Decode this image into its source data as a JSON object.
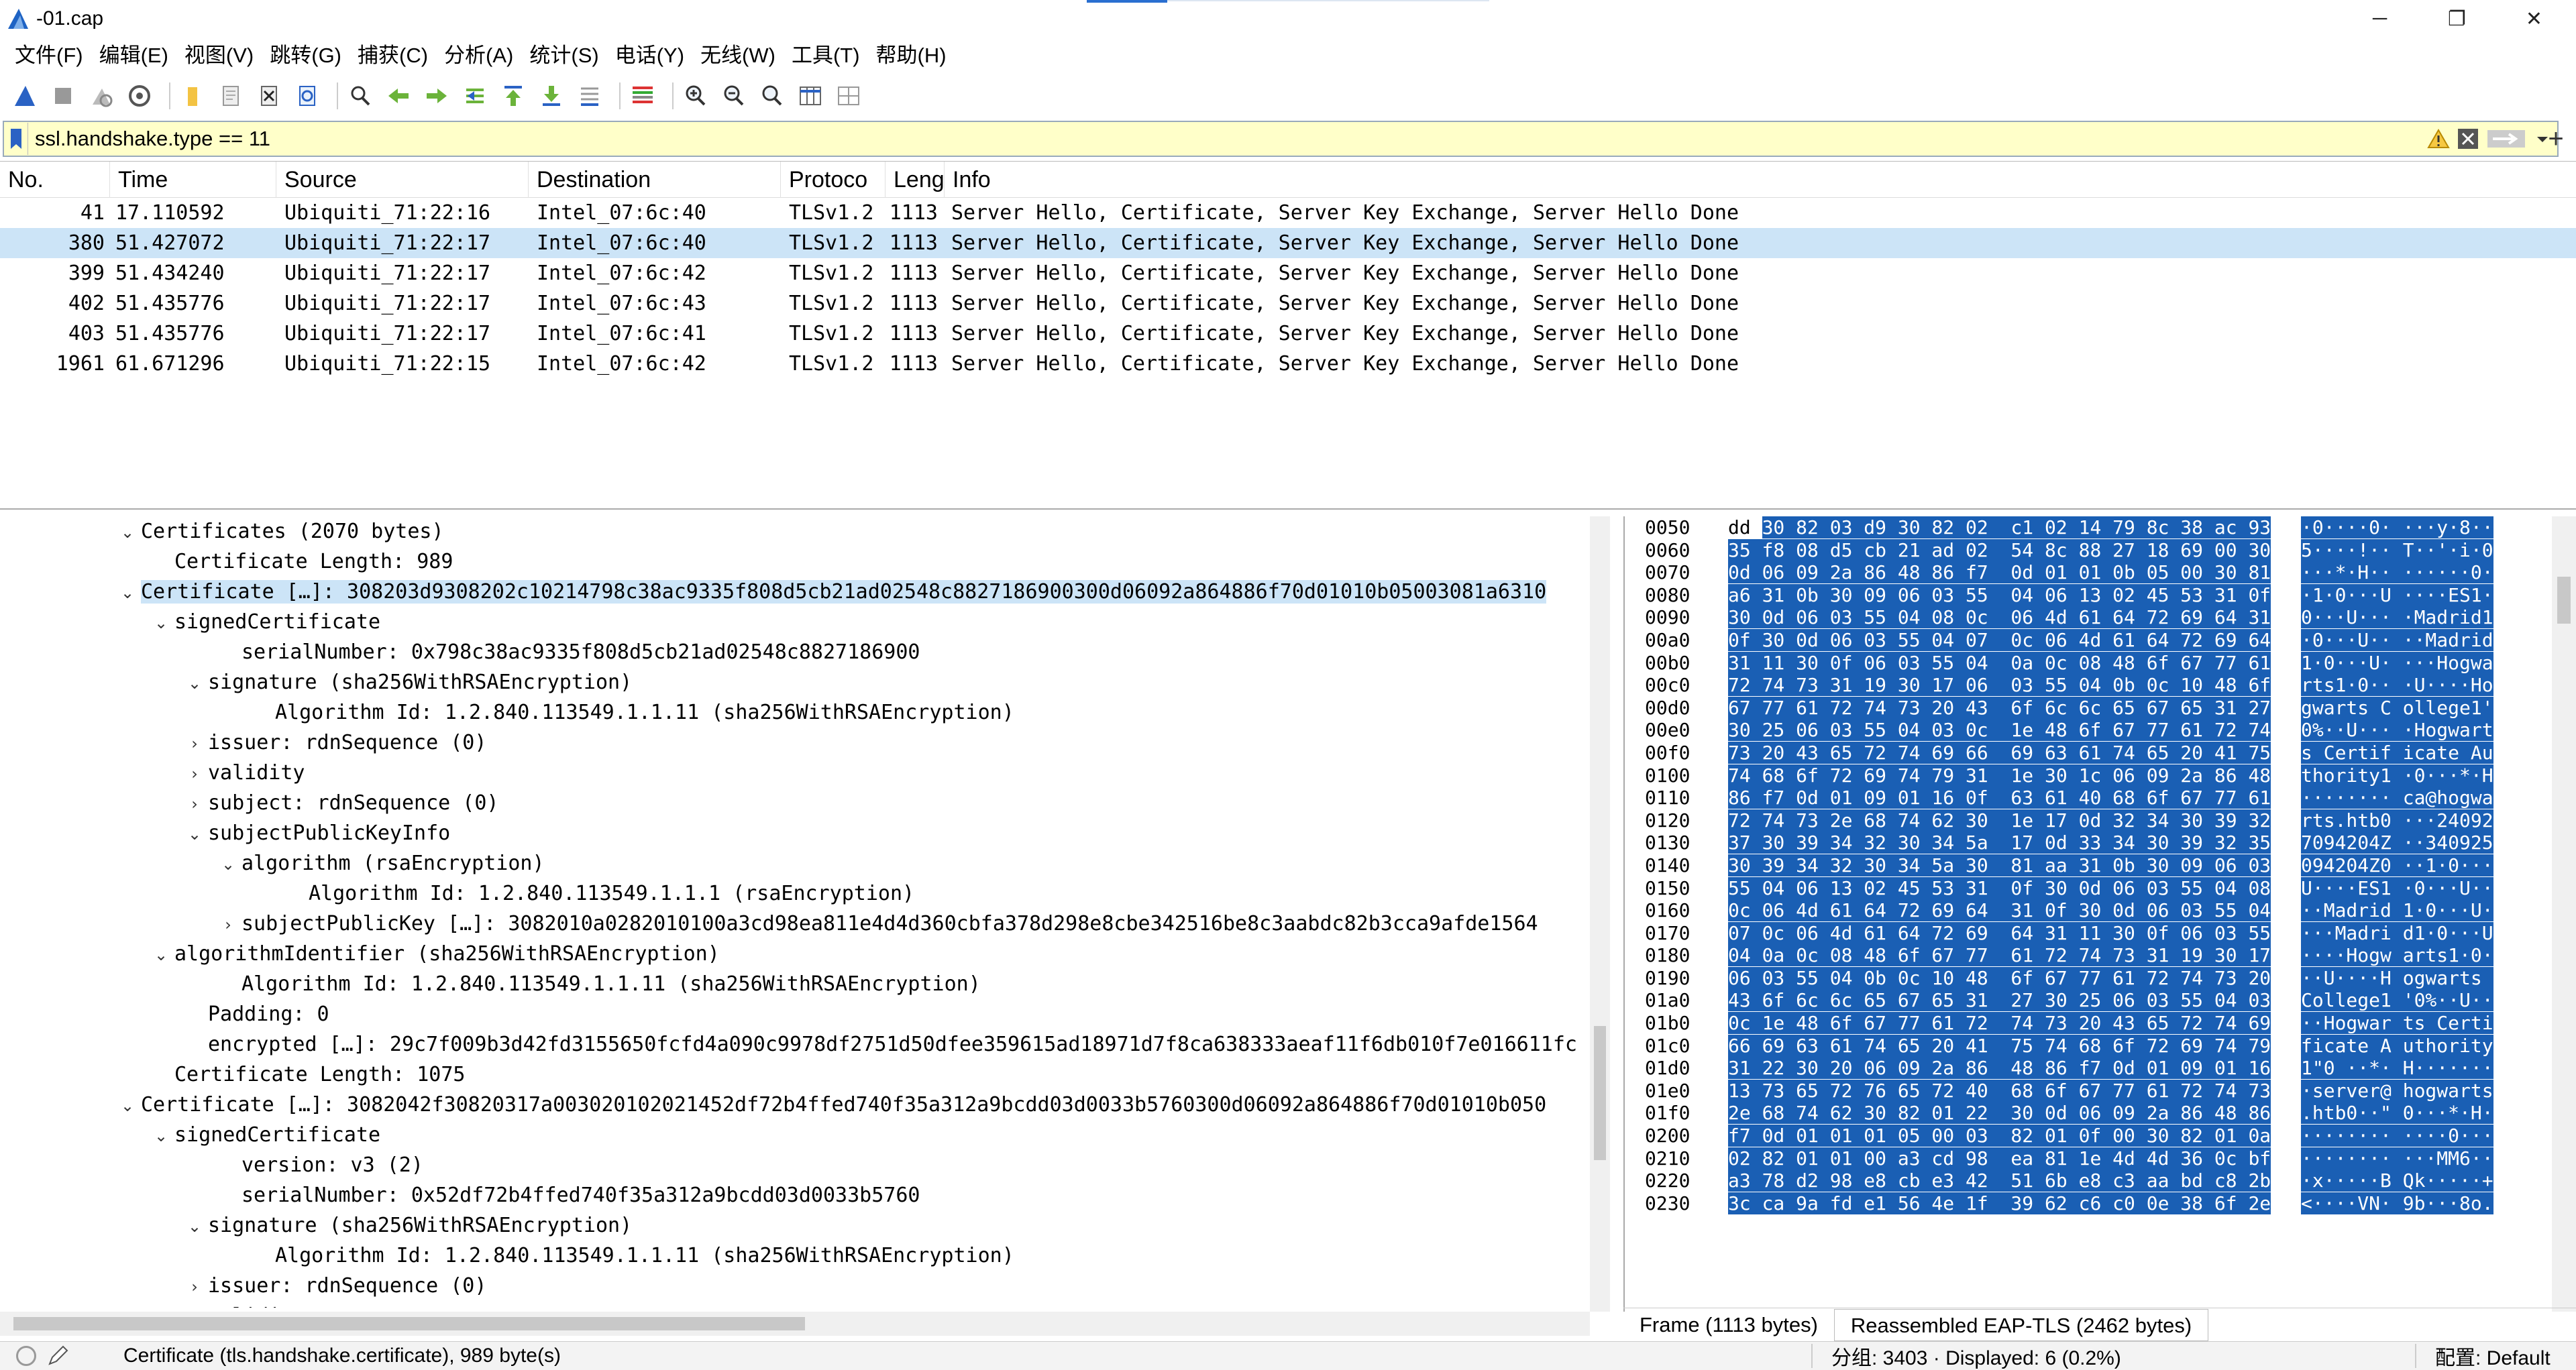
{
  "window": {
    "title": "-01.cap",
    "minimize": "─",
    "restore": "❐",
    "close": "✕"
  },
  "menu": [
    "文件(F)",
    "编辑(E)",
    "视图(V)",
    "跳转(G)",
    "捕获(C)",
    "分析(A)",
    "统计(S)",
    "电话(Y)",
    "无线(W)",
    "工具(T)",
    "帮助(H)"
  ],
  "toolbar_icons": [
    "shark-fin-start-icon",
    "stop-icon",
    "restart-icon",
    "capture-options-icon",
    "open-folder-icon",
    "save-icon",
    "close-file-icon",
    "reload-icon",
    "find-icon",
    "back-arrow-icon",
    "forward-arrow-icon",
    "go-to-packet-icon",
    "first-packet-icon",
    "last-packet-icon",
    "autoscroll-icon",
    "colorize-icon",
    "zoom-in-icon",
    "zoom-out-icon",
    "zoom-normal-icon",
    "resize-columns-icon",
    "layout-icon"
  ],
  "filter": {
    "value": "ssl.handshake.type == 11",
    "bg_color": "#ffffc9"
  },
  "packet_list": {
    "columns": [
      "No.",
      "Time",
      "Source",
      "Destination",
      "Protoco",
      "Lengt",
      "Info"
    ],
    "rows": [
      {
        "no": "41",
        "time": "17.110592",
        "src": "Ubiquiti_71:22:16",
        "dst": "Intel_07:6c:40",
        "proto": "TLSv1.2",
        "len": "1113",
        "info": "Server Hello, Certificate, Server Key Exchange, Server Hello Done"
      },
      {
        "no": "380",
        "time": "51.427072",
        "src": "Ubiquiti_71:22:17",
        "dst": "Intel_07:6c:40",
        "proto": "TLSv1.2",
        "len": "1113",
        "info": "Server Hello, Certificate, Server Key Exchange, Server Hello Done"
      },
      {
        "no": "399",
        "time": "51.434240",
        "src": "Ubiquiti_71:22:17",
        "dst": "Intel_07:6c:42",
        "proto": "TLSv1.2",
        "len": "1113",
        "info": "Server Hello, Certificate, Server Key Exchange, Server Hello Done"
      },
      {
        "no": "402",
        "time": "51.435776",
        "src": "Ubiquiti_71:22:17",
        "dst": "Intel_07:6c:43",
        "proto": "TLSv1.2",
        "len": "1113",
        "info": "Server Hello, Certificate, Server Key Exchange, Server Hello Done"
      },
      {
        "no": "403",
        "time": "51.435776",
        "src": "Ubiquiti_71:22:17",
        "dst": "Intel_07:6c:41",
        "proto": "TLSv1.2",
        "len": "1113",
        "info": "Server Hello, Certificate, Server Key Exchange, Server Hello Done"
      },
      {
        "no": "1961",
        "time": "61.671296",
        "src": "Ubiquiti_71:22:15",
        "dst": "Intel_07:6c:42",
        "proto": "TLSv1.2",
        "len": "1113",
        "info": "Server Hello, Certificate, Server Key Exchange, Server Hello Done"
      }
    ],
    "selected_no": "380"
  },
  "details": [
    {
      "indent": 4,
      "exp": "open",
      "text": "Certificates (2070 bytes)"
    },
    {
      "indent": 5,
      "exp": "none",
      "text": "Certificate Length: 989"
    },
    {
      "indent": 4,
      "exp": "open",
      "text": "Certificate […]: 308203d9308202c10214798c38ac9335f808d5cb21ad02548c8827186900300d06092a864886f70d01010b05003081a6310",
      "selected": true
    },
    {
      "indent": 5,
      "exp": "open",
      "text": "signedCertificate"
    },
    {
      "indent": 7,
      "exp": "none",
      "text": "serialNumber: 0x798c38ac9335f808d5cb21ad02548c8827186900"
    },
    {
      "indent": 6,
      "exp": "open",
      "text": "signature (sha256WithRSAEncryption)"
    },
    {
      "indent": 8,
      "exp": "none",
      "text": "Algorithm Id: 1.2.840.113549.1.1.11 (sha256WithRSAEncryption)"
    },
    {
      "indent": 6,
      "exp": "closed",
      "text": "issuer: rdnSequence (0)"
    },
    {
      "indent": 6,
      "exp": "closed",
      "text": "validity"
    },
    {
      "indent": 6,
      "exp": "closed",
      "text": "subject: rdnSequence (0)"
    },
    {
      "indent": 6,
      "exp": "open",
      "text": "subjectPublicKeyInfo"
    },
    {
      "indent": 7,
      "exp": "open",
      "text": "algorithm (rsaEncryption)"
    },
    {
      "indent": 9,
      "exp": "none",
      "text": "Algorithm Id: 1.2.840.113549.1.1.1 (rsaEncryption)"
    },
    {
      "indent": 7,
      "exp": "closed",
      "text": "subjectPublicKey […]: 3082010a0282010100a3cd98ea811e4d4d360cbfa378d298e8cbe342516be8c3aabdc82b3cca9afde1564"
    },
    {
      "indent": 5,
      "exp": "open",
      "text": "algorithmIdentifier (sha256WithRSAEncryption)"
    },
    {
      "indent": 7,
      "exp": "none",
      "text": "Algorithm Id: 1.2.840.113549.1.1.11 (sha256WithRSAEncryption)"
    },
    {
      "indent": 6,
      "exp": "none",
      "text": "Padding: 0"
    },
    {
      "indent": 6,
      "exp": "none",
      "text": "encrypted […]: 29c7f009b3d42fd3155650fcfd4a090c9978df2751d50dfee359615ad18971d7f8ca638333aeaf11f6db010f7e016611fc"
    },
    {
      "indent": 5,
      "exp": "none",
      "text": "Certificate Length: 1075"
    },
    {
      "indent": 4,
      "exp": "open",
      "text": "Certificate […]: 3082042f30820317a003020102021452df72b4ffed740f35a312a9bcdd03d0033b5760300d06092a864886f70d01010b050"
    },
    {
      "indent": 5,
      "exp": "open",
      "text": "signedCertificate"
    },
    {
      "indent": 7,
      "exp": "none",
      "text": "version: v3 (2)"
    },
    {
      "indent": 7,
      "exp": "none",
      "text": "serialNumber: 0x52df72b4ffed740f35a312a9bcdd03d0033b5760"
    },
    {
      "indent": 6,
      "exp": "open",
      "text": "signature (sha256WithRSAEncryption)"
    },
    {
      "indent": 8,
      "exp": "none",
      "text": "Algorithm Id: 1.2.840.113549.1.1.11 (sha256WithRSAEncryption)"
    },
    {
      "indent": 6,
      "exp": "closed",
      "text": "issuer: rdnSequence (0)"
    },
    {
      "indent": 6,
      "exp": "closed",
      "text": "validity"
    }
  ],
  "bytes": [
    {
      "off": "0050",
      "pre": "dd ",
      "hex": "30 82 03 d9 30 82 02  c1 02 14 79 8c 38 ac 93",
      "asc": "·0····0· ···y·8··"
    },
    {
      "off": "0060",
      "pre": "",
      "hex": "35 f8 08 d5 cb 21 ad 02  54 8c 88 27 18 69 00 30",
      "asc": "5····!·· T··'·i·0"
    },
    {
      "off": "0070",
      "pre": "",
      "hex": "0d 06 09 2a 86 48 86 f7  0d 01 01 0b 05 00 30 81",
      "asc": "···*·H·· ······0·"
    },
    {
      "off": "0080",
      "pre": "",
      "hex": "a6 31 0b 30 09 06 03 55  04 06 13 02 45 53 31 0f",
      "asc": "·1·0···U ····ES1·"
    },
    {
      "off": "0090",
      "pre": "",
      "hex": "30 0d 06 03 55 04 08 0c  06 4d 61 64 72 69 64 31",
      "asc": "0···U··· ·Madrid1"
    },
    {
      "off": "00a0",
      "pre": "",
      "hex": "0f 30 0d 06 03 55 04 07  0c 06 4d 61 64 72 69 64",
      "asc": "·0···U·· ··Madrid"
    },
    {
      "off": "00b0",
      "pre": "",
      "hex": "31 11 30 0f 06 03 55 04  0a 0c 08 48 6f 67 77 61",
      "asc": "1·0···U· ···Hogwa"
    },
    {
      "off": "00c0",
      "pre": "",
      "hex": "72 74 73 31 19 30 17 06  03 55 04 0b 0c 10 48 6f",
      "asc": "rts1·0·· ·U····Ho"
    },
    {
      "off": "00d0",
      "pre": "",
      "hex": "67 77 61 72 74 73 20 43  6f 6c 6c 65 67 65 31 27",
      "asc": "gwarts C ollege1'"
    },
    {
      "off": "00e0",
      "pre": "",
      "hex": "30 25 06 03 55 04 03 0c  1e 48 6f 67 77 61 72 74",
      "asc": "0%··U··· ·Hogwart"
    },
    {
      "off": "00f0",
      "pre": "",
      "hex": "73 20 43 65 72 74 69 66  69 63 61 74 65 20 41 75",
      "asc": "s Certif icate Au"
    },
    {
      "off": "0100",
      "pre": "",
      "hex": "74 68 6f 72 69 74 79 31  1e 30 1c 06 09 2a 86 48",
      "asc": "thority1 ·0···*·H"
    },
    {
      "off": "0110",
      "pre": "",
      "hex": "86 f7 0d 01 09 01 16 0f  63 61 40 68 6f 67 77 61",
      "asc": "········ ca@hogwa"
    },
    {
      "off": "0120",
      "pre": "",
      "hex": "72 74 73 2e 68 74 62 30  1e 17 0d 32 34 30 39 32",
      "asc": "rts.htb0 ···24092"
    },
    {
      "off": "0130",
      "pre": "",
      "hex": "37 30 39 34 32 30 34 5a  17 0d 33 34 30 39 32 35",
      "asc": "7094204Z ··340925"
    },
    {
      "off": "0140",
      "pre": "",
      "hex": "30 39 34 32 30 34 5a 30  81 aa 31 0b 30 09 06 03",
      "asc": "094204Z0 ··1·0···"
    },
    {
      "off": "0150",
      "pre": "",
      "hex": "55 04 06 13 02 45 53 31  0f 30 0d 06 03 55 04 08",
      "asc": "U····ES1 ·0···U··"
    },
    {
      "off": "0160",
      "pre": "",
      "hex": "0c 06 4d 61 64 72 69 64  31 0f 30 0d 06 03 55 04",
      "asc": "··Madrid 1·0···U·"
    },
    {
      "off": "0170",
      "pre": "",
      "hex": "07 0c 06 4d 61 64 72 69  64 31 11 30 0f 06 03 55",
      "asc": "···Madri d1·0···U"
    },
    {
      "off": "0180",
      "pre": "",
      "hex": "04 0a 0c 08 48 6f 67 77  61 72 74 73 31 19 30 17",
      "asc": "····Hogw arts1·0·"
    },
    {
      "off": "0190",
      "pre": "",
      "hex": "06 03 55 04 0b 0c 10 48  6f 67 77 61 72 74 73 20",
      "asc": "··U····H ogwarts "
    },
    {
      "off": "01a0",
      "pre": "",
      "hex": "43 6f 6c 6c 65 67 65 31  27 30 25 06 03 55 04 03",
      "asc": "College1 '0%··U··"
    },
    {
      "off": "01b0",
      "pre": "",
      "hex": "0c 1e 48 6f 67 77 61 72  74 73 20 43 65 72 74 69",
      "asc": "··Hogwar ts Certi"
    },
    {
      "off": "01c0",
      "pre": "",
      "hex": "66 69 63 61 74 65 20 41  75 74 68 6f 72 69 74 79",
      "asc": "ficate A uthority"
    },
    {
      "off": "01d0",
      "pre": "",
      "hex": "31 22 30 20 06 09 2a 86  48 86 f7 0d 01 09 01 16",
      "asc": "1\"0 ··*· H·······"
    },
    {
      "off": "01e0",
      "pre": "",
      "hex": "13 73 65 72 76 65 72 40  68 6f 67 77 61 72 74 73",
      "asc": "·server@ hogwarts"
    },
    {
      "off": "01f0",
      "pre": "",
      "hex": "2e 68 74 62 30 82 01 22  30 0d 06 09 2a 86 48 86",
      "asc": ".htb0··\" 0···*·H·"
    },
    {
      "off": "0200",
      "pre": "",
      "hex": "f7 0d 01 01 01 05 00 03  82 01 0f 00 30 82 01 0a",
      "asc": "········ ····0···"
    },
    {
      "off": "0210",
      "pre": "",
      "hex": "02 82 01 01 00 a3 cd 98  ea 81 1e 4d 4d 36 0c bf",
      "asc": "········ ···MM6··"
    },
    {
      "off": "0220",
      "pre": "",
      "hex": "a3 78 d2 98 e8 cb e3 42  51 6b e8 c3 aa bd c8 2b",
      "asc": "·x·····B Qk·····+"
    },
    {
      "off": "0230",
      "pre": "",
      "hex": "3c ca 9a fd e1 56 4e 1f  39 62 c6 c0 0e 38 6f 2e",
      "asc": "<····VN· 9b···8o."
    }
  ],
  "byte_tabs": [
    "Frame (1113 bytes)",
    "Reassembled EAP-TLS (2462 bytes)"
  ],
  "status": {
    "left": "Certificate (tls.handshake.certificate), 989 byte(s)",
    "mid": "分组: 3403 · Displayed: 6 (0.2%)",
    "right": "配置: Default"
  },
  "colors": {
    "selection": "#cce4f7",
    "hex_highlight": "#1a5fb4",
    "filter_bg": "#ffffc9"
  }
}
